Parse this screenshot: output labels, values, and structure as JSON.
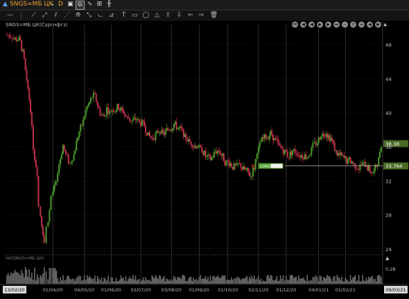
{
  "toolbar": {
    "symbol": "SNGS=МБ ЦК",
    "period": "D",
    "icons": [
      "save-icon",
      "multi-chart-icon",
      "compare-icon",
      "indicator-icon",
      "bar-type-icon"
    ]
  },
  "drawing_tools": [
    "line-tool-icon",
    "ray-tool-icon",
    "trendline-tool-icon",
    "channel-tool-icon",
    "fibonacci-tool-icon",
    "pitchfork-tool-icon",
    "text-tool-icon",
    "rectangle-tool-icon",
    "ellipse-tool-icon",
    "arrow-up-tool-icon",
    "arrow-down-tool-icon",
    "arrow-left-tool-icon",
    "arrow-right-tool-icon",
    "delete-tool-icon"
  ],
  "chart_title": "SNGS=МБ ЦК(Сургнфгз)",
  "volume_title": "Vol(SNGS=МБ ЦК)",
  "nav_buttons": [
    "⏮",
    "◀",
    "◀",
    "▶",
    "▶",
    "⏭",
    "−",
    "+",
    "↔",
    "◀",
    "▶"
  ],
  "price_axis": {
    "ticks": [
      "48",
      "44",
      "40",
      "36",
      "32",
      "28",
      "24"
    ]
  },
  "volume_axis": {
    "ticks": [
      "0,2B"
    ]
  },
  "last_price_label": "36,38",
  "order_line": {
    "label": "LONG",
    "price_label": "33,764"
  },
  "x_axis": {
    "start_date": "13/02/20",
    "end_date": "09/03/21",
    "ticks": [
      "01/04/20",
      "04/05/20",
      "01/06/20",
      "02/07/20",
      "03/08/20",
      "01/09/20",
      "01/10/20",
      "02/11/20",
      "01/12/20",
      "04/01/21",
      "01/02/21"
    ]
  },
  "colors": {
    "up": "#4a9a2a",
    "down": "#c0304a",
    "background": "#000000",
    "grid": "#2e2e2e",
    "last_price": "#4a6a28"
  },
  "chart_data": {
    "type": "candlestick",
    "title": "SNGS=МБ ЦК(Сургнфгз)",
    "close_series": [
      [
        "13/02/20",
        49.0
      ],
      [
        "20/02/20",
        48.6
      ],
      [
        "27/02/20",
        47.0
      ],
      [
        "02/03/20",
        43.5
      ],
      [
        "06/03/20",
        40.5
      ],
      [
        "10/03/20",
        36.0
      ],
      [
        "13/03/20",
        33.0
      ],
      [
        "17/03/20",
        29.0
      ],
      [
        "19/03/20",
        26.0
      ],
      [
        "23/03/20",
        24.8
      ],
      [
        "25/03/20",
        26.5
      ],
      [
        "27/03/20",
        28.5
      ],
      [
        "30/03/20",
        30.2
      ],
      [
        "01/04/20",
        32.0
      ],
      [
        "06/04/20",
        34.0
      ],
      [
        "09/04/20",
        36.2
      ],
      [
        "13/04/20",
        35.0
      ],
      [
        "16/04/20",
        34.0
      ],
      [
        "20/04/20",
        34.8
      ],
      [
        "23/04/20",
        36.5
      ],
      [
        "27/04/20",
        37.8
      ],
      [
        "30/04/20",
        39.0
      ],
      [
        "04/05/20",
        40.3
      ],
      [
        "07/05/20",
        41.5
      ],
      [
        "12/05/20",
        42.0
      ],
      [
        "15/05/20",
        41.0
      ],
      [
        "19/05/20",
        40.0
      ],
      [
        "22/05/20",
        39.6
      ],
      [
        "26/05/20",
        40.5
      ],
      [
        "29/05/20",
        40.0
      ],
      [
        "01/06/20",
        40.5
      ],
      [
        "05/06/20",
        40.8
      ],
      [
        "10/06/20",
        40.2
      ],
      [
        "15/06/20",
        39.4
      ],
      [
        "19/06/20",
        39.0
      ],
      [
        "24/06/20",
        39.3
      ],
      [
        "29/06/20",
        38.8
      ],
      [
        "02/07/20",
        38.5
      ],
      [
        "07/07/20",
        37.8
      ],
      [
        "10/07/20",
        37.0
      ],
      [
        "15/07/20",
        37.5
      ],
      [
        "20/07/20",
        38.0
      ],
      [
        "24/07/20",
        37.6
      ],
      [
        "29/07/20",
        38.3
      ],
      [
        "03/08/20",
        38.7
      ],
      [
        "07/08/20",
        38.1
      ],
      [
        "12/08/20",
        37.6
      ],
      [
        "17/08/20",
        36.9
      ],
      [
        "21/08/20",
        36.5
      ],
      [
        "26/08/20",
        36.2
      ],
      [
        "01/09/20",
        35.6
      ],
      [
        "04/09/20",
        34.9
      ],
      [
        "09/09/20",
        34.6
      ],
      [
        "14/09/20",
        35.2
      ],
      [
        "18/09/20",
        35.6
      ],
      [
        "23/09/20",
        34.6
      ],
      [
        "28/09/20",
        34.2
      ],
      [
        "01/10/20",
        33.9
      ],
      [
        "06/10/20",
        33.6
      ],
      [
        "12/10/20",
        33.8
      ],
      [
        "16/10/20",
        33.2
      ],
      [
        "21/10/20",
        32.6
      ],
      [
        "26/10/20",
        33.6
      ],
      [
        "30/10/20",
        35.6
      ],
      [
        "02/11/20",
        36.6
      ],
      [
        "06/11/20",
        37.2
      ],
      [
        "11/11/20",
        37.6
      ],
      [
        "16/11/20",
        36.8
      ],
      [
        "20/11/20",
        36.0
      ],
      [
        "25/11/20",
        35.4
      ],
      [
        "01/12/20",
        35.0
      ],
      [
        "04/12/20",
        35.6
      ],
      [
        "09/12/20",
        35.4
      ],
      [
        "14/12/20",
        35.0
      ],
      [
        "18/12/20",
        34.9
      ],
      [
        "23/12/20",
        35.6
      ],
      [
        "29/12/20",
        36.6
      ],
      [
        "04/01/21",
        37.6
      ],
      [
        "08/01/21",
        37.8
      ],
      [
        "13/01/21",
        37.0
      ],
      [
        "18/01/21",
        35.8
      ],
      [
        "22/01/21",
        35.0
      ],
      [
        "27/01/21",
        34.6
      ],
      [
        "01/02/21",
        34.2
      ],
      [
        "05/02/21",
        34.1
      ],
      [
        "10/02/21",
        33.6
      ],
      [
        "15/02/21",
        33.9
      ],
      [
        "19/02/21",
        34.0
      ],
      [
        "24/02/21",
        33.1
      ],
      [
        "01/03/21",
        33.0
      ],
      [
        "04/03/21",
        34.5
      ],
      [
        "09/03/21",
        36.38
      ]
    ],
    "yrange": [
      23.5,
      50
    ],
    "last_price": 36.38,
    "order_price": 33.764,
    "volume_axis_max": "0,2B",
    "grid": true
  }
}
